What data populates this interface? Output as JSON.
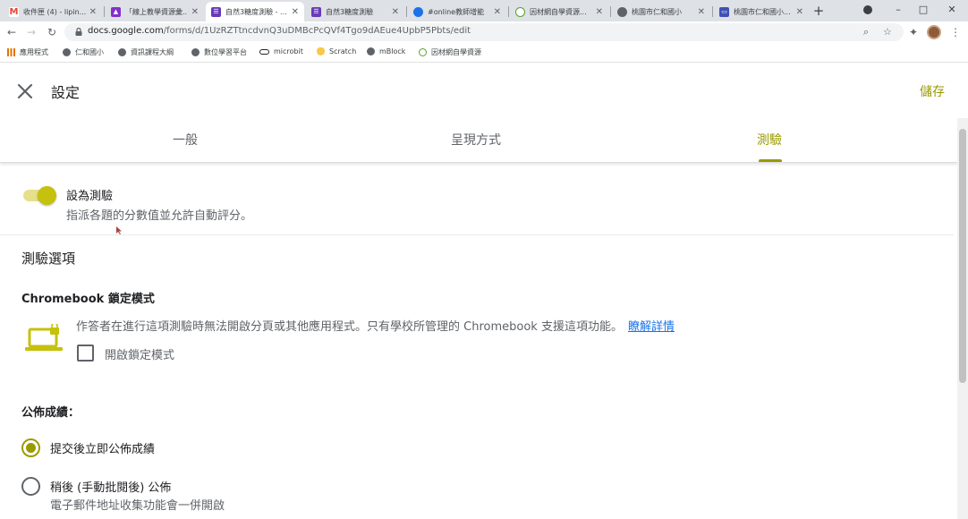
{
  "browser": {
    "tabs": [
      {
        "title": "收件匣 (4) - lipin...",
        "icon": "gmail-icon",
        "color": "#ea4335"
      },
      {
        "title": "「線上教學資源彙...",
        "icon": "purple-doc-icon",
        "color": "#8430ce"
      },
      {
        "title": "自然3糖度測驗 - ...",
        "icon": "forms-icon",
        "color": "#673ab7"
      },
      {
        "title": "自然3糖度測驗",
        "icon": "forms-icon",
        "color": "#673ab7"
      },
      {
        "title": "#online教師增能",
        "icon": "globe-icon",
        "color": "#1a73e8"
      },
      {
        "title": "因材網自學資源...",
        "icon": "leaf-icon",
        "color": "#5aa02c"
      },
      {
        "title": "桃園市仁和國小",
        "icon": "globe-icon",
        "color": "#5f6368"
      },
      {
        "title": "桃園市仁和國小...",
        "icon": "sites-icon",
        "color": "#3f51b5"
      }
    ],
    "new_tab": "+",
    "window_controls": {
      "minimize": "–",
      "maximize": "□",
      "close": "✕"
    },
    "url": {
      "host": "docs.google.com",
      "path": "/forms/d/1UzRZTtncdvnQ3uDMBcPcQVf4Tgo9dAEue4UpbP5Pbts/edit"
    },
    "bookmarks": [
      {
        "label": "應用程式",
        "icon": "apps-grid-icon",
        "color": "#e37400"
      },
      {
        "label": "仁和國小",
        "icon": "globe-icon",
        "color": "#5f6368"
      },
      {
        "label": "資訊課程大綱",
        "icon": "globe-icon",
        "color": "#5f6368"
      },
      {
        "label": "數位學習平台",
        "icon": "globe-icon",
        "color": "#5f6368"
      },
      {
        "label": "microbit",
        "icon": "microbit-icon",
        "color": "#202124"
      },
      {
        "label": "Scratch",
        "icon": "scratch-icon",
        "color": "#f7c948"
      },
      {
        "label": "mBlock",
        "icon": "globe-icon",
        "color": "#5f6368"
      },
      {
        "label": "因材網自學資源",
        "icon": "leaf-icon",
        "color": "#5aa02c"
      }
    ]
  },
  "settings": {
    "title": "設定",
    "save": "儲存",
    "accent": "#9a9a00",
    "tabs": [
      {
        "label": "一般",
        "active": false
      },
      {
        "label": "呈現方式",
        "active": false
      },
      {
        "label": "測驗",
        "active": true
      }
    ],
    "quiz": {
      "toggle_on": true,
      "title": "設為測驗",
      "description": "指派各題的分數值並允許自動評分。"
    },
    "quiz_options_title": "測驗選項",
    "chromebook": {
      "heading": "Chromebook 鎖定模式",
      "description": "作答者在進行這項測驗時無法開啟分頁或其他應用程式。只有學校所管理的 Chromebook 支援這項功能。",
      "link": "瞭解詳情",
      "checkbox_label": "開啟鎖定模式",
      "checked": false
    },
    "release": {
      "heading": "公佈成績：",
      "options": [
        {
          "label": "提交後立即公佈成績",
          "checked": true
        },
        {
          "label": "稍後 (手動批閱後) 公佈",
          "sub": "電子郵件地址收集功能會一併開啟",
          "checked": false
        }
      ]
    }
  }
}
